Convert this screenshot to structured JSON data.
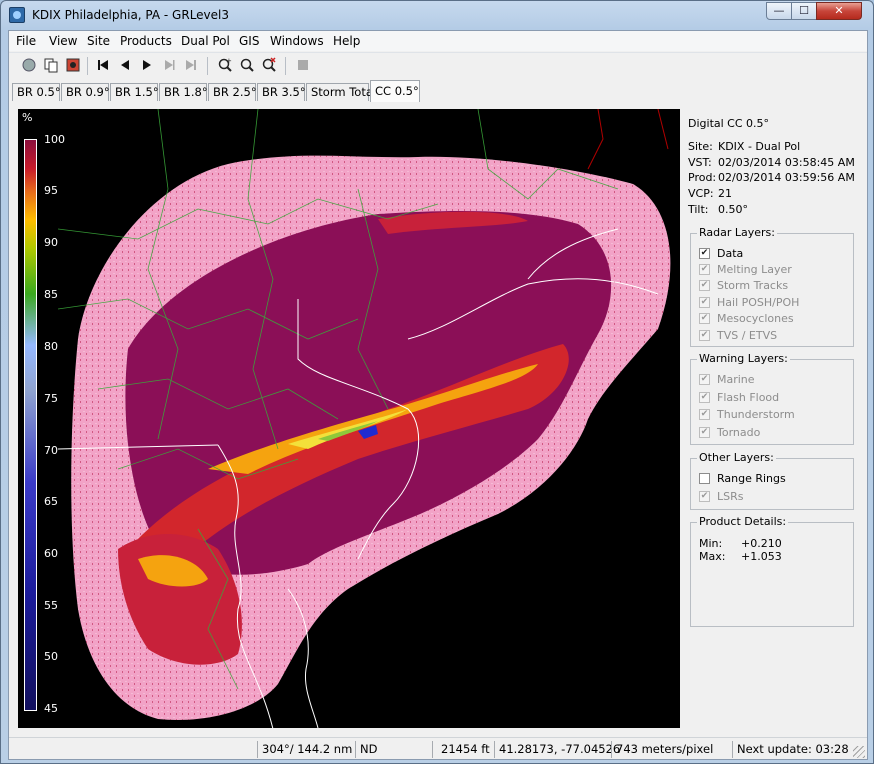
{
  "window": {
    "title": "KDIX Philadelphia, PA - GRLevel3",
    "min": "—",
    "max": "☐",
    "close": "✕"
  },
  "menu": [
    "File",
    "View",
    "Site",
    "Products",
    "Dual Pol",
    "GIS",
    "Windows",
    "Help"
  ],
  "toolbar_icons": [
    "new-window-icon",
    "copy-icon",
    "save-image-icon",
    "first-frame-icon",
    "step-back-icon",
    "play-icon",
    "step-forward-icon",
    "last-frame-icon",
    "zoom-in-icon",
    "zoom-out-icon",
    "zoom-reset-icon",
    "stop-icon"
  ],
  "tabs": [
    "BR 0.5°",
    "BR 0.9°",
    "BR 1.5°",
    "BR 1.8°",
    "BR 2.5°",
    "BR 3.5°",
    "Storm Total",
    "CC 0.5°"
  ],
  "active_tab": "CC 0.5°",
  "scale": {
    "unit": "%",
    "labels": [
      "100",
      "95",
      "90",
      "85",
      "80",
      "75",
      "70",
      "65",
      "60",
      "55",
      "50",
      "45"
    ]
  },
  "product": {
    "title": "Digital CC 0.5°",
    "site_label": "Site:",
    "site": "KDIX - Dual Pol",
    "vst_label": "VST:",
    "vst": "02/03/2014  03:58:45 AM",
    "prod_label": "Prod:",
    "prod": "02/03/2014  03:59:56 AM",
    "vcp_label": "VCP:",
    "vcp": "21",
    "tilt_label": "Tilt:",
    "tilt": "0.50°"
  },
  "radar_layers": {
    "title": "Radar Layers:",
    "items": [
      {
        "label": "Data",
        "checked": true,
        "enabled": true
      },
      {
        "label": "Melting Layer",
        "checked": true,
        "enabled": false
      },
      {
        "label": "Storm Tracks",
        "checked": true,
        "enabled": false
      },
      {
        "label": "Hail POSH/POH",
        "checked": true,
        "enabled": false
      },
      {
        "label": "Mesocyclones",
        "checked": true,
        "enabled": false
      },
      {
        "label": "TVS / ETVS",
        "checked": true,
        "enabled": false
      }
    ]
  },
  "warning_layers": {
    "title": "Warning Layers:",
    "items": [
      {
        "label": "Marine",
        "checked": true,
        "enabled": false
      },
      {
        "label": "Flash Flood",
        "checked": true,
        "enabled": false
      },
      {
        "label": "Thunderstorm",
        "checked": true,
        "enabled": false
      },
      {
        "label": "Tornado",
        "checked": true,
        "enabled": false
      }
    ]
  },
  "other_layers": {
    "title": "Other Layers:",
    "items": [
      {
        "label": "Range Rings",
        "checked": false,
        "enabled": true
      },
      {
        "label": "LSRs",
        "checked": true,
        "enabled": false
      }
    ]
  },
  "details": {
    "title": "Product Details:",
    "min_label": "Min:",
    "min": "+0.210",
    "max_label": "Max:",
    "max": "+1.053"
  },
  "status": {
    "azimuth_range": "304°/ 144.2 nm",
    "value": "ND",
    "height": "21454 ft",
    "coords": "41.28173, -77.04526",
    "resolution": "743 meters/pixel",
    "next_update": "Next update: 03:28"
  },
  "colors": {
    "background": "#000000",
    "purple_core": "#8b0f57",
    "pink_edge": "#f2a3c7"
  }
}
